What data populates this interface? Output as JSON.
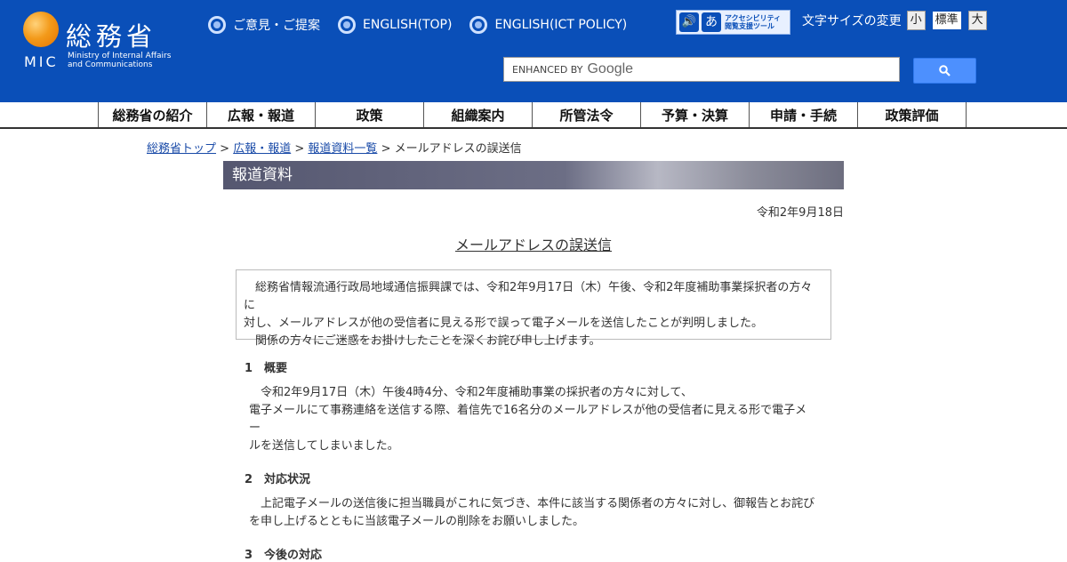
{
  "header": {
    "logo_kanji": "総務省",
    "logo_abbr": "MIC",
    "logo_english_line1": "Ministry of Internal Affairs",
    "logo_english_line2": "and Communications",
    "links": [
      {
        "label": "ご意見・ご提案"
      },
      {
        "label": "ENGLISH(TOP)"
      },
      {
        "label": "ENGLISH(ICT POLICY)"
      }
    ],
    "accessibility_line1": "アクセシビリティ",
    "accessibility_line2": "閲覧支援ツール",
    "accessibility_mark": "あ",
    "font_size_label": "文字サイズの変更",
    "font_size_small": "小",
    "font_size_standard": "標準",
    "font_size_large": "大",
    "search_enhanced": "ENHANCED BY",
    "search_google": "Google"
  },
  "nav": [
    "総務省の紹介",
    "広報・報道",
    "政策",
    "組織案内",
    "所管法令",
    "予算・決算",
    "申請・手続",
    "政策評価"
  ],
  "breadcrumb": {
    "top": "総務省トップ",
    "pr": "広報・報道",
    "list": "報道資料一覧",
    "current": "メールアドレスの誤送信",
    "sep": ">"
  },
  "banner": "報道資料",
  "date": "令和2年9月18日",
  "title": "メールアドレスの誤送信",
  "notice": {
    "line1": "　総務省情報流通行政局地域通信振興課では、令和2年9月17日（木）午後、令和2年度補助事業採択者の方々に",
    "line2": "対し、メールアドレスが他の受信者に見える形で誤って電子メールを送信したことが判明しました。",
    "line3": "　関係の方々にご迷惑をお掛けしたことを深くお詫び申し上げます。"
  },
  "sections": [
    {
      "heading": "1　概要",
      "lines": [
        "　令和2年9月17日（木）午後4時4分、令和2年度補助事業の採択者の方々に対して、",
        "電子メールにて事務連絡を送信する際、着信先で16名分のメールアドレスが他の受信者に見える形で電子メー",
        "ルを送信してしまいました。"
      ]
    },
    {
      "heading": "2　対応状況",
      "lines": [
        "　上記電子メールの送信後に担当職員がこれに気づき、本件に該当する関係者の方々に対し、御報告とお詫び",
        "を申し上げるとともに当該電子メールの削除をお願いしました。"
      ]
    },
    {
      "heading": "3　今後の対応",
      "lines": []
    }
  ]
}
